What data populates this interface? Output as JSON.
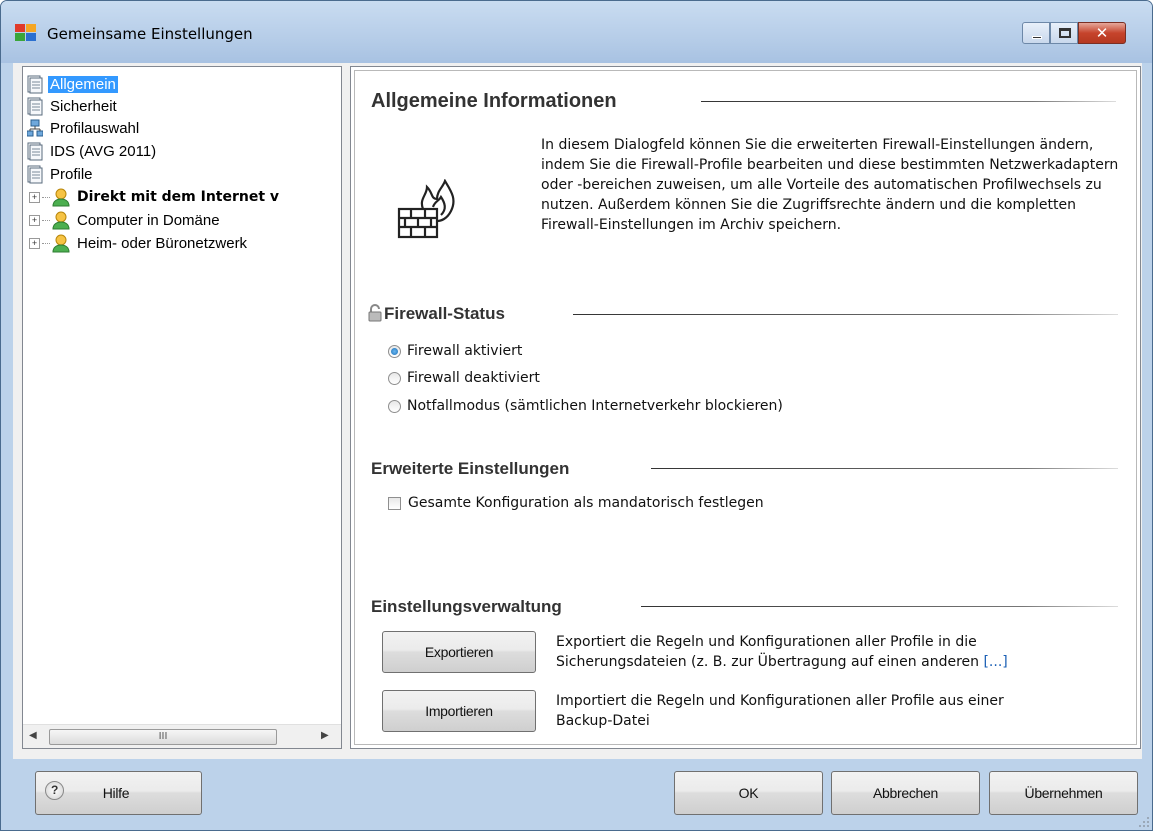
{
  "window": {
    "title": "Gemeinsame Einstellungen",
    "title_icon": "avg-logo-icon",
    "controls": [
      "minimize-icon",
      "maximize-icon",
      "close-icon"
    ]
  },
  "tree": {
    "items": [
      {
        "label": "Allgemein",
        "icon": "document-icon",
        "selected": true
      },
      {
        "label": "Sicherheit",
        "icon": "document-icon"
      },
      {
        "label": "Profilauswahl",
        "icon": "network-icon"
      },
      {
        "label": "IDS (AVG 2011)",
        "icon": "document-icon"
      },
      {
        "label": "Profile",
        "icon": "document-icon"
      },
      {
        "label": "Direkt mit dem Internet v",
        "icon": "user-icon",
        "expander": "+",
        "bold": true
      },
      {
        "label": "Computer in Domäne",
        "icon": "user-icon",
        "expander": "+"
      },
      {
        "label": "Heim- oder Büronetzwerk",
        "icon": "user-icon",
        "expander": "+"
      }
    ],
    "scroll_left": "◀",
    "scroll_right": "▶",
    "scroll_thumb": "III"
  },
  "content": {
    "info_title": "Allgemeine Informationen",
    "info_icon": "firewall-icon",
    "info_text": "In diesem Dialogfeld können Sie die erweiterten Firewall-Einstellungen ändern, indem Sie die Firewall-Profile bearbeiten und diese bestimmten Netzwerkadaptern oder -bereichen zuweisen, um alle Vorteile des automatischen Profilwechsels zu nutzen. Außerdem können Sie die Zugriffsrechte ändern und die kompletten Firewall-Einstellungen im Archiv speichern.",
    "status_title": "Firewall-Status",
    "status_icon": "lock-icon",
    "status_options": [
      {
        "label": "Firewall aktiviert",
        "checked": true
      },
      {
        "label": "Firewall deaktiviert",
        "checked": false
      },
      {
        "label": "Notfallmodus (sämtlichen Internetverkehr blockieren)",
        "checked": false
      }
    ],
    "advanced_title": "Erweiterte Einstellungen",
    "advanced_checkbox": {
      "label": "Gesamte Konfiguration als mandatorisch festlegen",
      "checked": false
    },
    "manage_title": "Einstellungsverwaltung",
    "export_button": "Exportieren",
    "export_text_1": "Exportiert die Regeln und Konfigurationen aller Profile in die",
    "export_text_2": "Sicherungsdateien (z. B. zur Übertragung auf einen anderen",
    "export_more": "[...]",
    "import_button": "Importieren",
    "import_text_1": "Importiert die Regeln und Konfigurationen aller Profile aus einer",
    "import_text_2": "Backup-Datei"
  },
  "footer": {
    "help_glyph": "?",
    "help_button": "Hilfe",
    "ok_button": "OK",
    "cancel_button": "Abbrechen",
    "apply_button": "Übernehmen"
  }
}
